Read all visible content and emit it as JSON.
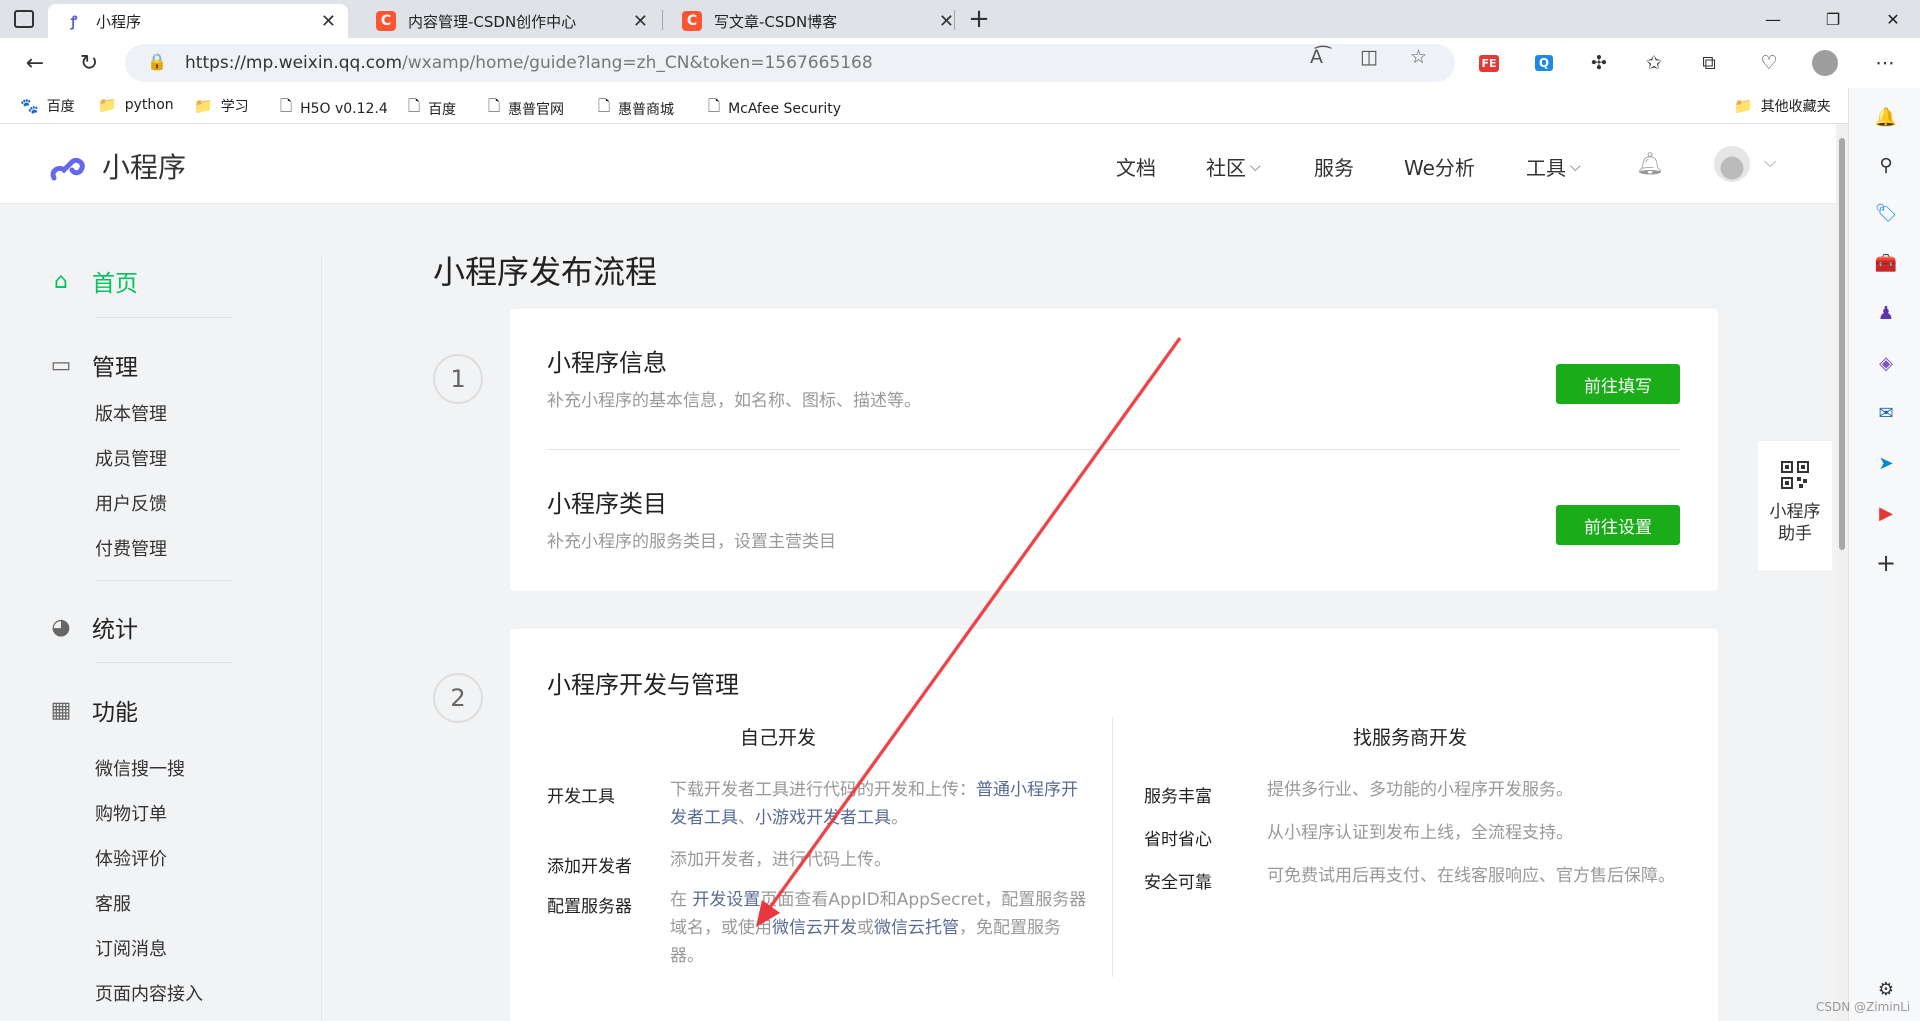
{
  "browser": {
    "tabs": [
      {
        "title": "小程序",
        "active": true,
        "icon": "mini-program-icon"
      },
      {
        "title": "内容管理-CSDN创作中心",
        "active": false,
        "icon": "csdn-icon"
      },
      {
        "title": "写文章-CSDN博客",
        "active": false,
        "icon": "csdn-icon"
      }
    ],
    "url_host": "https://mp.weixin.qq.com",
    "url_path": "/wxamp/home/guide?lang=zh_CN&token=1567665168",
    "bookmarks": [
      {
        "label": "百度",
        "icon": "paw-icon"
      },
      {
        "label": "python",
        "icon": "folder-icon"
      },
      {
        "label": "学习",
        "icon": "folder-icon"
      },
      {
        "label": "H5O v0.12.4",
        "icon": "page-icon"
      },
      {
        "label": "百度",
        "icon": "page-icon"
      },
      {
        "label": "惠普官网",
        "icon": "page-icon"
      },
      {
        "label": "惠普商城",
        "icon": "page-icon"
      },
      {
        "label": "McAfee Security",
        "icon": "page-icon"
      }
    ],
    "other_bookmarks": "其他收藏夹"
  },
  "header": {
    "logo_text": "小程序",
    "nav": [
      {
        "label": "文档",
        "dropdown": false
      },
      {
        "label": "社区",
        "dropdown": true
      },
      {
        "label": "服务",
        "dropdown": false
      },
      {
        "label": "We分析",
        "dropdown": false
      },
      {
        "label": "工具",
        "dropdown": true
      }
    ]
  },
  "sidebar": {
    "home": "首页",
    "manage": "管理",
    "manage_items": [
      "版本管理",
      "成员管理",
      "用户反馈",
      "付费管理"
    ],
    "stats": "统计",
    "features": "功能",
    "feature_items": [
      "微信搜一搜",
      "购物订单",
      "体验评价",
      "客服",
      "订阅消息",
      "页面内容接入"
    ]
  },
  "main": {
    "page_title": "小程序发布流程",
    "step1": {
      "num": "1",
      "info_title": "小程序信息",
      "info_desc": "补充小程序的基本信息，如名称、图标、描述等。",
      "info_btn": "前往填写",
      "cat_title": "小程序类目",
      "cat_desc": "补充小程序的服务类目，设置主营类目",
      "cat_btn": "前往设置"
    },
    "step2": {
      "num": "2",
      "title": "小程序开发与管理",
      "self_title": "自己开发",
      "provider_title": "找服务商开发",
      "self_rows": [
        {
          "label": "开发工具",
          "pre": "下载开发者工具进行代码的开发和上传：",
          "link1": "普通小程序开发者工具",
          "mid": "、",
          "link2": "小游戏开发者工具",
          "post": "。"
        },
        {
          "label": "添加开发者",
          "text": "添加开发者，进行代码上传。"
        },
        {
          "label": "配置服务器",
          "pre": "在 ",
          "link1": "开发设置",
          "mid": "页面查看AppID和AppSecret，配置服务器域名，或使用",
          "link2": "微信云开发",
          "mid2": "或",
          "link3": "微信云托管",
          "post": "，免配置服务器。"
        }
      ],
      "provider_rows": [
        {
          "label": "服务丰富",
          "text": "提供多行业、多功能的小程序开发服务。"
        },
        {
          "label": "省时省心",
          "text": "从小程序认证到发布上线，全流程支持。"
        },
        {
          "label": "安全可靠",
          "text": "可免费试用后再支付、在线客服响应、官方售后保障。"
        }
      ]
    }
  },
  "helper": {
    "label": "小程序助手"
  },
  "watermark": "CSDN @ZiminLi",
  "colors": {
    "brand_green": "#07c160",
    "button_green": "#1aad19",
    "link": "#576b95",
    "annotation_arrow": "#e8383d"
  }
}
